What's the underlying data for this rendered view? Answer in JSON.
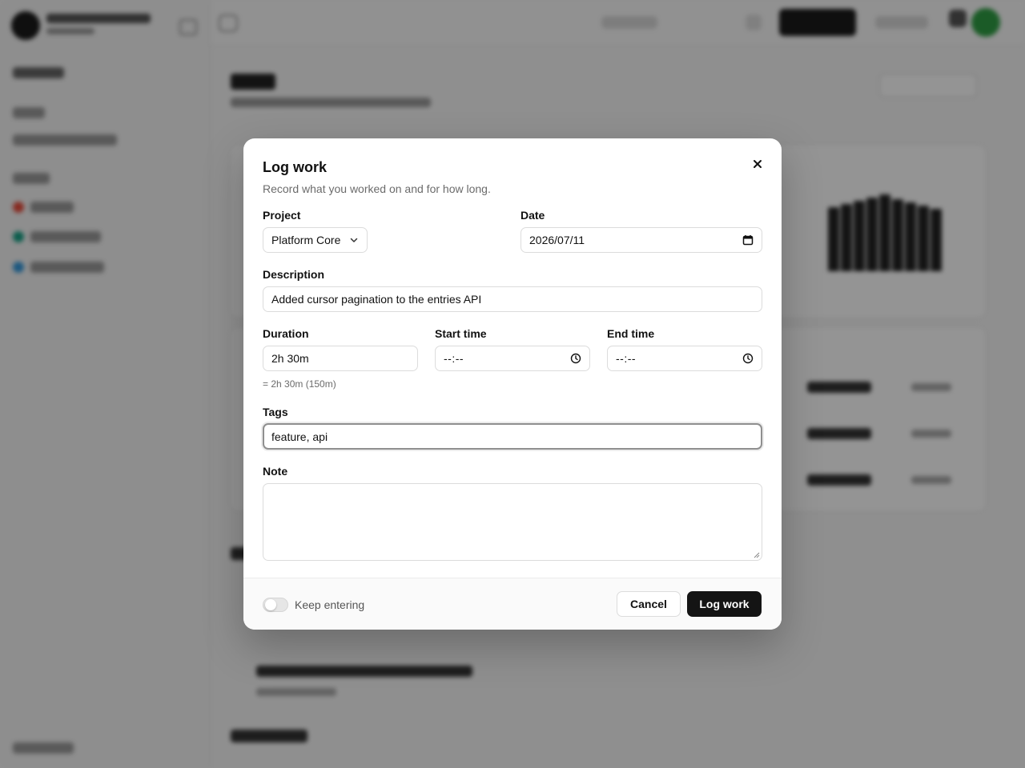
{
  "modal": {
    "title": "Log work",
    "description": "Record what you worked on and for how long.",
    "close_icon": "close-icon"
  },
  "form": {
    "project": {
      "label": "Project",
      "value": "Platform Core",
      "icon": "chevron-down-icon"
    },
    "date": {
      "label": "Date",
      "value": "2026/07/11",
      "icon": "calendar-icon"
    },
    "description": {
      "label": "Description",
      "value": "Added cursor pagination to the entries API"
    },
    "duration": {
      "label": "Duration",
      "value": "2h 30m",
      "hint": "= 2h 30m (150m)"
    },
    "start_time": {
      "label": "Start time",
      "value": "--:--",
      "icon": "clock-icon"
    },
    "end_time": {
      "label": "End time",
      "value": "--:--",
      "icon": "clock-icon"
    },
    "tags": {
      "label": "Tags",
      "value": "feature, api"
    },
    "note": {
      "label": "Note",
      "value": ""
    }
  },
  "footer": {
    "keep_entering_label": "Keep entering",
    "keep_entering_on": false,
    "cancel_label": "Cancel",
    "submit_label": "Log work"
  },
  "colors": {
    "primary_button": "#141414",
    "overlay": "rgba(0,0,0,0.42)",
    "avatar_accent": "#2f9e44"
  }
}
